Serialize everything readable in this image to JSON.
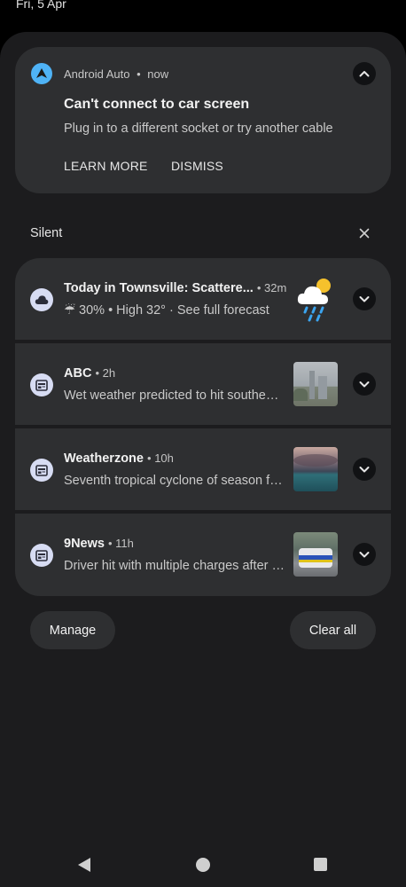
{
  "status": {
    "date": "Fri, 5 Apr"
  },
  "android_auto": {
    "app_name": "Android Auto",
    "separator": "•",
    "time": "now",
    "title": "Can't connect to car screen",
    "text": "Plug in to a different socket or try another cable",
    "actions": {
      "learn_more": "LEARN MORE",
      "dismiss": "DISMISS"
    },
    "icon": "android-auto-icon",
    "accent": "#4fb3f6"
  },
  "silent": {
    "label": "Silent",
    "close_icon": "close-icon",
    "notifications": [
      {
        "title": "Today in Townsville: Scattere...",
        "time": "32m",
        "text": "☔ 30% • High 32° · See full forecast",
        "icon": "weather-cloud-icon",
        "thumb": "cloud-rain-sun-icon"
      },
      {
        "title": "ABC",
        "time": "2h",
        "text": "Wet weather predicted to hit southeast Queensland",
        "icon": "news-icon",
        "thumb": "news-photo-thumbnail"
      },
      {
        "title": "Weatherzone",
        "time": "10h",
        "text": "Seventh tropical cyclone of season forms",
        "icon": "news-icon",
        "thumb": "news-photo-thumbnail"
      },
      {
        "title": "9News",
        "time": "11h",
        "text": "Driver hit with multiple charges after crash",
        "icon": "news-icon",
        "thumb": "news-photo-thumbnail"
      }
    ]
  },
  "buttons": {
    "manage": "Manage",
    "clear_all": "Clear all"
  },
  "navbar": {
    "back": "back-icon",
    "home": "home-icon",
    "recents": "recents-icon"
  }
}
